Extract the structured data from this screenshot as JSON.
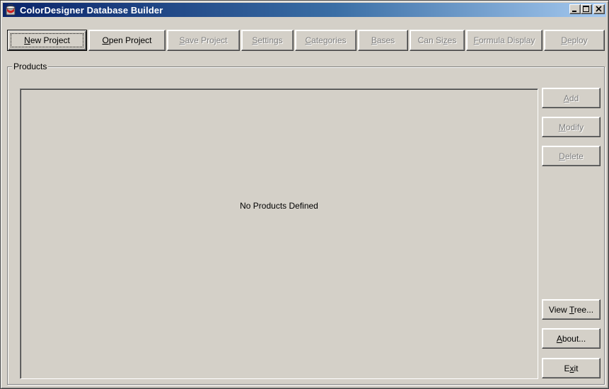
{
  "window": {
    "title": "ColorDesigner Database Builder",
    "icon": "app-paint-can-icon"
  },
  "toolbar": {
    "buttons": [
      {
        "pre": "",
        "key": "N",
        "post": "ew Project",
        "enabled": true
      },
      {
        "pre": "",
        "key": "O",
        "post": "pen Project",
        "enabled": true
      },
      {
        "pre": "",
        "key": "S",
        "post": "ave Project",
        "enabled": false
      },
      {
        "pre": "",
        "key": "S",
        "post": "ettings",
        "enabled": false
      },
      {
        "pre": "",
        "key": "C",
        "post": "ategories",
        "enabled": false
      },
      {
        "pre": "",
        "key": "B",
        "post": "ases",
        "enabled": false
      },
      {
        "pre": "Can Si",
        "key": "z",
        "post": "es",
        "enabled": false
      },
      {
        "pre": "",
        "key": "F",
        "post": "ormula Display",
        "enabled": false
      },
      {
        "pre": "",
        "key": "D",
        "post": "eploy",
        "enabled": false
      }
    ]
  },
  "products": {
    "group_label": "Products",
    "empty_message": "No Products Defined"
  },
  "side": {
    "add": {
      "pre": "",
      "key": "A",
      "post": "dd",
      "enabled": false
    },
    "modify": {
      "pre": "",
      "key": "M",
      "post": "odify",
      "enabled": false
    },
    "delete": {
      "pre": "",
      "key": "D",
      "post": "elete",
      "enabled": false
    },
    "view_tree": {
      "pre": "View ",
      "key": "T",
      "post": "ree...",
      "enabled": true
    },
    "about": {
      "pre": "",
      "key": "A",
      "post": "bout...",
      "enabled": true
    },
    "exit": {
      "pre": "E",
      "key": "x",
      "post": "it",
      "enabled": true
    }
  },
  "colors": {
    "face": "#d4d0c8",
    "title_start": "#0a246a",
    "title_end": "#a6caf0",
    "disabled_text": "#808080"
  }
}
